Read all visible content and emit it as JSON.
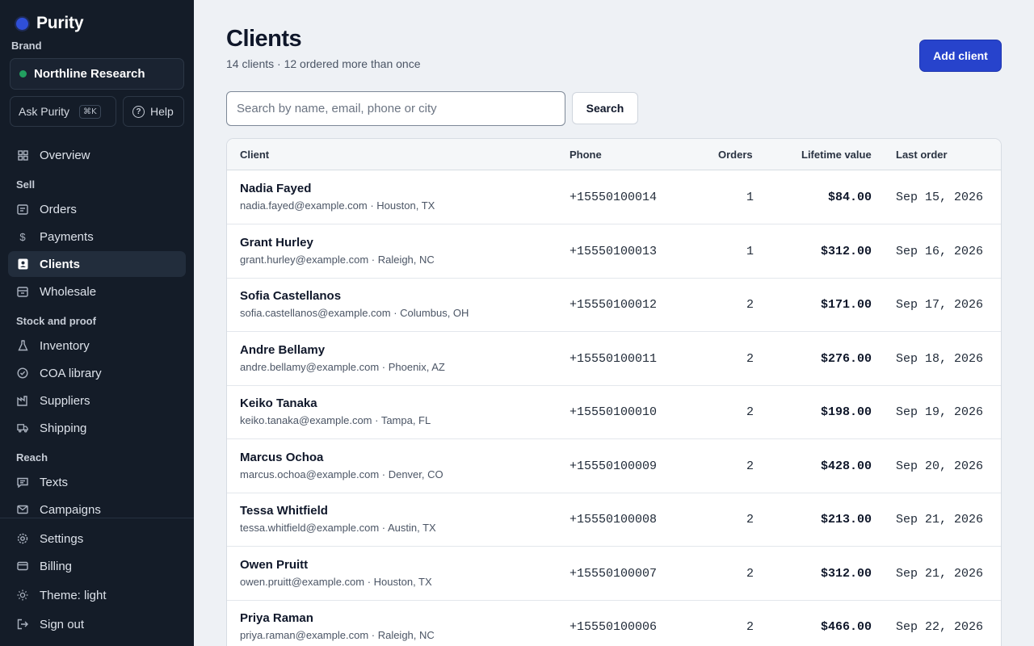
{
  "app": {
    "name": "Purity"
  },
  "brand": {
    "label": "Brand",
    "name": "Northline Research"
  },
  "quick": {
    "ask_label": "Ask Purity",
    "ask_shortcut": "⌘K",
    "help_label": "Help"
  },
  "nav": {
    "overview": "Overview",
    "sell_section": "Sell",
    "orders": "Orders",
    "payments": "Payments",
    "clients": "Clients",
    "wholesale": "Wholesale",
    "stock_section": "Stock and proof",
    "inventory": "Inventory",
    "coa": "COA library",
    "suppliers": "Suppliers",
    "shipping": "Shipping",
    "reach_section": "Reach",
    "texts": "Texts",
    "campaigns": "Campaigns",
    "settings": "Settings",
    "billing": "Billing",
    "theme": "Theme: light",
    "signout": "Sign out"
  },
  "header": {
    "title": "Clients",
    "subtitle": "14 clients · 12 ordered more than once",
    "add_label": "Add client"
  },
  "search": {
    "placeholder": "Search by name, email, phone or city",
    "button": "Search"
  },
  "table": {
    "columns": [
      "Client",
      "Phone",
      "Orders",
      "Lifetime value",
      "Last order"
    ],
    "rows": [
      {
        "name": "Nadia Fayed",
        "meta": "nadia.fayed@example.com · Houston, TX",
        "phone": "+15550100014",
        "orders": "1",
        "value": "$84.00",
        "last": "Sep 15, 2026"
      },
      {
        "name": "Grant Hurley",
        "meta": "grant.hurley@example.com · Raleigh, NC",
        "phone": "+15550100013",
        "orders": "1",
        "value": "$312.00",
        "last": "Sep 16, 2026"
      },
      {
        "name": "Sofia Castellanos",
        "meta": "sofia.castellanos@example.com · Columbus, OH",
        "phone": "+15550100012",
        "orders": "2",
        "value": "$171.00",
        "last": "Sep 17, 2026"
      },
      {
        "name": "Andre Bellamy",
        "meta": "andre.bellamy@example.com · Phoenix, AZ",
        "phone": "+15550100011",
        "orders": "2",
        "value": "$276.00",
        "last": "Sep 18, 2026"
      },
      {
        "name": "Keiko Tanaka",
        "meta": "keiko.tanaka@example.com · Tampa, FL",
        "phone": "+15550100010",
        "orders": "2",
        "value": "$198.00",
        "last": "Sep 19, 2026"
      },
      {
        "name": "Marcus Ochoa",
        "meta": "marcus.ochoa@example.com · Denver, CO",
        "phone": "+15550100009",
        "orders": "2",
        "value": "$428.00",
        "last": "Sep 20, 2026"
      },
      {
        "name": "Tessa Whitfield",
        "meta": "tessa.whitfield@example.com · Austin, TX",
        "phone": "+15550100008",
        "orders": "2",
        "value": "$213.00",
        "last": "Sep 21, 2026"
      },
      {
        "name": "Owen Pruitt",
        "meta": "owen.pruitt@example.com · Houston, TX",
        "phone": "+15550100007",
        "orders": "2",
        "value": "$312.00",
        "last": "Sep 21, 2026"
      },
      {
        "name": "Priya Raman",
        "meta": "priya.raman@example.com · Raleigh, NC",
        "phone": "+15550100006",
        "orders": "2",
        "value": "$466.00",
        "last": "Sep 22, 2026"
      }
    ]
  },
  "colors": {
    "accent": "#2743cc",
    "sidebar_bg": "#141c28",
    "brand_status": "#22a060"
  }
}
